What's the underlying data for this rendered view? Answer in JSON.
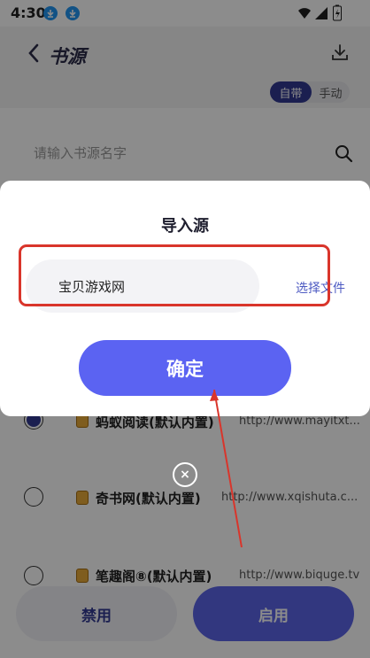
{
  "status_bar": {
    "time": "4:30"
  },
  "header": {
    "title": "书源",
    "tabs": [
      "自带",
      "手动"
    ],
    "selected_tab": "自带"
  },
  "search": {
    "placeholder": "请输入书源名字"
  },
  "list": [
    {
      "name": "蚂蚁阅读(默认内置)",
      "url": "http://www.mayitxt...",
      "selected": true
    },
    {
      "name": "奇书网(默认内置)",
      "url": "http://www.xqishuta.c...",
      "selected": false
    },
    {
      "name": "笔趣阁⑧(默认内置)",
      "url": "http://www.biquge.tv",
      "selected": false
    }
  ],
  "footer": {
    "disable_label": "禁用",
    "enable_label": "启用"
  },
  "dialog": {
    "title": "导入源",
    "input_value": "宝贝游戏网",
    "choose_file_label": "选择文件",
    "confirm_label": "确定",
    "close_glyph": "×"
  },
  "colors": {
    "accent": "#5b63f2",
    "brand_dark": "#323a92",
    "annotation_red": "#d9352b"
  }
}
